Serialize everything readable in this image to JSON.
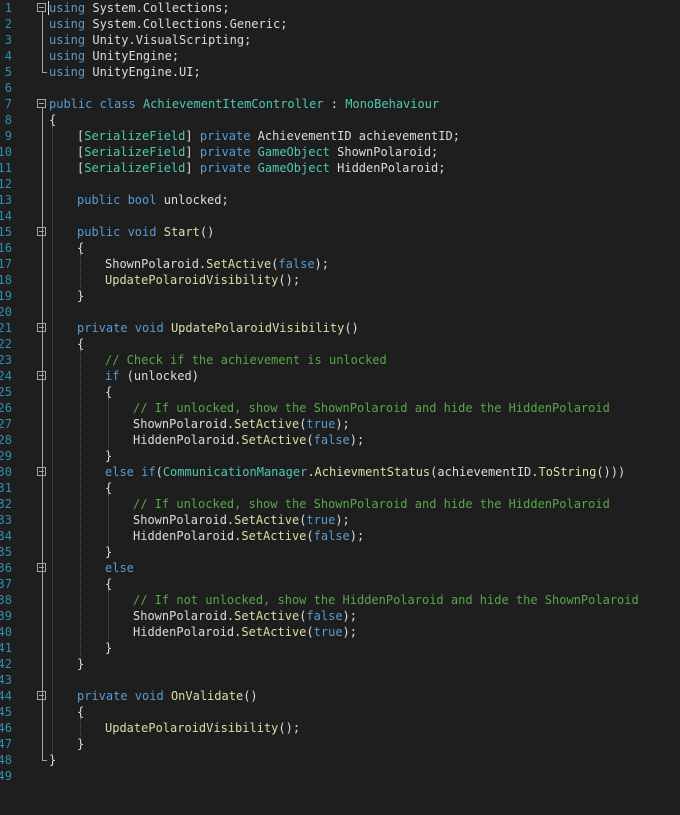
{
  "editor": {
    "lines": [
      {
        "n": "1",
        "indent": 0,
        "tokens": [
          [
            "kw",
            "using"
          ],
          [
            "pl",
            " System.Collections;"
          ]
        ]
      },
      {
        "n": "2",
        "indent": 0,
        "tokens": [
          [
            "kw",
            "using"
          ],
          [
            "pl",
            " System.Collections.Generic;"
          ]
        ]
      },
      {
        "n": "3",
        "indent": 0,
        "tokens": [
          [
            "kw",
            "using"
          ],
          [
            "pl",
            " Unity.VisualScripting;"
          ]
        ]
      },
      {
        "n": "4",
        "indent": 0,
        "tokens": [
          [
            "kw",
            "using"
          ],
          [
            "pl",
            " UnityEngine;"
          ]
        ]
      },
      {
        "n": "5",
        "indent": 0,
        "tokens": [
          [
            "kw",
            "using"
          ],
          [
            "pl",
            " UnityEngine.UI;"
          ]
        ]
      },
      {
        "n": "6",
        "indent": 0,
        "tokens": []
      },
      {
        "n": "7",
        "indent": 0,
        "tokens": [
          [
            "kw",
            "public class"
          ],
          [
            "pl",
            " "
          ],
          [
            "ty",
            "AchievementItemController"
          ],
          [
            "pl",
            " : "
          ],
          [
            "ty",
            "MonoBehaviour"
          ]
        ]
      },
      {
        "n": "8",
        "indent": 0,
        "tokens": [
          [
            "pl",
            "{"
          ]
        ]
      },
      {
        "n": "9",
        "indent": 1,
        "tokens": [
          [
            "pl",
            "["
          ],
          [
            "ty",
            "SerializeField"
          ],
          [
            "pl",
            "] "
          ],
          [
            "kw",
            "private"
          ],
          [
            "pl",
            " AchievementID achievementID;"
          ]
        ]
      },
      {
        "n": "10",
        "indent": 1,
        "tokens": [
          [
            "pl",
            "["
          ],
          [
            "ty",
            "SerializeField"
          ],
          [
            "pl",
            "] "
          ],
          [
            "kw",
            "private"
          ],
          [
            "pl",
            " "
          ],
          [
            "ty",
            "GameObject"
          ],
          [
            "pl",
            " ShownPolaroid;"
          ]
        ]
      },
      {
        "n": "11",
        "indent": 1,
        "tokens": [
          [
            "pl",
            "["
          ],
          [
            "ty",
            "SerializeField"
          ],
          [
            "pl",
            "] "
          ],
          [
            "kw",
            "private"
          ],
          [
            "pl",
            " "
          ],
          [
            "ty",
            "GameObject"
          ],
          [
            "pl",
            " HiddenPolaroid;"
          ]
        ]
      },
      {
        "n": "12",
        "indent": 1,
        "tokens": []
      },
      {
        "n": "13",
        "indent": 1,
        "tokens": [
          [
            "kw",
            "public bool"
          ],
          [
            "pl",
            " unlocked;"
          ]
        ]
      },
      {
        "n": "14",
        "indent": 1,
        "tokens": []
      },
      {
        "n": "15",
        "indent": 1,
        "tokens": [
          [
            "kw",
            "public void"
          ],
          [
            "pl",
            " "
          ],
          [
            "fn",
            "Start"
          ],
          [
            "pl",
            "()"
          ]
        ]
      },
      {
        "n": "16",
        "indent": 1,
        "tokens": [
          [
            "pl",
            "{"
          ]
        ]
      },
      {
        "n": "17",
        "indent": 2,
        "tokens": [
          [
            "pl",
            "ShownPolaroid."
          ],
          [
            "fn",
            "SetActive"
          ],
          [
            "pl",
            "("
          ],
          [
            "kw",
            "false"
          ],
          [
            "pl",
            ");"
          ]
        ]
      },
      {
        "n": "18",
        "indent": 2,
        "tokens": [
          [
            "fn",
            "UpdatePolaroidVisibility"
          ],
          [
            "pl",
            "();"
          ]
        ]
      },
      {
        "n": "19",
        "indent": 1,
        "tokens": [
          [
            "pl",
            "}"
          ]
        ]
      },
      {
        "n": "20",
        "indent": 1,
        "tokens": []
      },
      {
        "n": "21",
        "indent": 1,
        "tokens": [
          [
            "kw",
            "private void"
          ],
          [
            "pl",
            " "
          ],
          [
            "fn",
            "UpdatePolaroidVisibility"
          ],
          [
            "pl",
            "()"
          ]
        ]
      },
      {
        "n": "22",
        "indent": 1,
        "tokens": [
          [
            "pl",
            "{"
          ]
        ]
      },
      {
        "n": "23",
        "indent": 2,
        "tokens": [
          [
            "cm",
            "// Check if the achievement is unlocked"
          ]
        ]
      },
      {
        "n": "24",
        "indent": 2,
        "tokens": [
          [
            "kw",
            "if"
          ],
          [
            "pl",
            " (unlocked)"
          ]
        ]
      },
      {
        "n": "25",
        "indent": 2,
        "tokens": [
          [
            "pl",
            "{"
          ]
        ]
      },
      {
        "n": "26",
        "indent": 3,
        "tokens": [
          [
            "cm",
            "// If unlocked, show the ShownPolaroid and hide the HiddenPolaroid"
          ]
        ]
      },
      {
        "n": "27",
        "indent": 3,
        "tokens": [
          [
            "pl",
            "ShownPolaroid."
          ],
          [
            "fn",
            "SetActive"
          ],
          [
            "pl",
            "("
          ],
          [
            "kw",
            "true"
          ],
          [
            "pl",
            ");"
          ]
        ]
      },
      {
        "n": "28",
        "indent": 3,
        "tokens": [
          [
            "pl",
            "HiddenPolaroid."
          ],
          [
            "fn",
            "SetActive"
          ],
          [
            "pl",
            "("
          ],
          [
            "kw",
            "false"
          ],
          [
            "pl",
            ");"
          ]
        ]
      },
      {
        "n": "29",
        "indent": 2,
        "tokens": [
          [
            "pl",
            "}"
          ]
        ]
      },
      {
        "n": "30",
        "indent": 2,
        "tokens": [
          [
            "kw",
            "else if"
          ],
          [
            "pl",
            "("
          ],
          [
            "ty",
            "CommunicationManager"
          ],
          [
            "pl",
            "."
          ],
          [
            "fn",
            "AchievmentStatus"
          ],
          [
            "pl",
            "(achievementID."
          ],
          [
            "fn",
            "ToString"
          ],
          [
            "pl",
            "()))"
          ]
        ]
      },
      {
        "n": "31",
        "indent": 2,
        "tokens": [
          [
            "pl",
            "{"
          ]
        ]
      },
      {
        "n": "32",
        "indent": 3,
        "tokens": [
          [
            "cm",
            "// If unlocked, show the ShownPolaroid and hide the HiddenPolaroid"
          ]
        ]
      },
      {
        "n": "33",
        "indent": 3,
        "tokens": [
          [
            "pl",
            "ShownPolaroid."
          ],
          [
            "fn",
            "SetActive"
          ],
          [
            "pl",
            "("
          ],
          [
            "kw",
            "true"
          ],
          [
            "pl",
            ");"
          ]
        ]
      },
      {
        "n": "34",
        "indent": 3,
        "tokens": [
          [
            "pl",
            "HiddenPolaroid."
          ],
          [
            "fn",
            "SetActive"
          ],
          [
            "pl",
            "("
          ],
          [
            "kw",
            "false"
          ],
          [
            "pl",
            ");"
          ]
        ]
      },
      {
        "n": "35",
        "indent": 2,
        "tokens": [
          [
            "pl",
            "}"
          ]
        ]
      },
      {
        "n": "36",
        "indent": 2,
        "tokens": [
          [
            "kw",
            "else"
          ]
        ]
      },
      {
        "n": "37",
        "indent": 2,
        "tokens": [
          [
            "pl",
            "{"
          ]
        ]
      },
      {
        "n": "38",
        "indent": 3,
        "tokens": [
          [
            "cm",
            "// If not unlocked, show the HiddenPolaroid and hide the ShownPolaroid"
          ]
        ]
      },
      {
        "n": "39",
        "indent": 3,
        "tokens": [
          [
            "pl",
            "ShownPolaroid."
          ],
          [
            "fn",
            "SetActive"
          ],
          [
            "pl",
            "("
          ],
          [
            "kw",
            "false"
          ],
          [
            "pl",
            ");"
          ]
        ]
      },
      {
        "n": "40",
        "indent": 3,
        "tokens": [
          [
            "pl",
            "HiddenPolaroid."
          ],
          [
            "fn",
            "SetActive"
          ],
          [
            "pl",
            "("
          ],
          [
            "kw",
            "true"
          ],
          [
            "pl",
            ");"
          ]
        ]
      },
      {
        "n": "41",
        "indent": 2,
        "tokens": [
          [
            "pl",
            "}"
          ]
        ]
      },
      {
        "n": "42",
        "indent": 1,
        "tokens": [
          [
            "pl",
            "}"
          ]
        ]
      },
      {
        "n": "43",
        "indent": 1,
        "tokens": []
      },
      {
        "n": "44",
        "indent": 1,
        "tokens": [
          [
            "kw",
            "private void"
          ],
          [
            "pl",
            " "
          ],
          [
            "fn",
            "OnValidate"
          ],
          [
            "pl",
            "()"
          ]
        ]
      },
      {
        "n": "45",
        "indent": 1,
        "tokens": [
          [
            "pl",
            "{"
          ]
        ]
      },
      {
        "n": "46",
        "indent": 2,
        "tokens": [
          [
            "fn",
            "UpdatePolaroidVisibility"
          ],
          [
            "pl",
            "();"
          ]
        ]
      },
      {
        "n": "47",
        "indent": 1,
        "tokens": [
          [
            "pl",
            "}"
          ]
        ]
      },
      {
        "n": "48",
        "indent": 0,
        "tokens": [
          [
            "pl",
            "}"
          ]
        ]
      },
      {
        "n": "49",
        "indent": 0,
        "tokens": []
      }
    ],
    "fold_lines": [
      "1",
      "7",
      "15",
      "21",
      "24",
      "30",
      "36",
      "44"
    ]
  },
  "colors": {
    "background": "#1e1e1e",
    "keyword": "#569cd6",
    "type": "#4ec9b0",
    "comment": "#57a64a",
    "method": "#dcdcaa",
    "plain": "#dcdcdc",
    "line_number": "#2b91af"
  }
}
